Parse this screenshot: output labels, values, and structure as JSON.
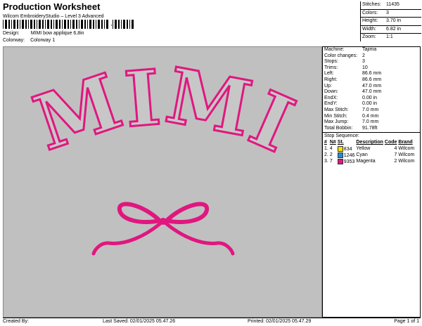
{
  "header": {
    "title": "Production Worksheet",
    "software": "Wilcom EmbroideryStudio – Level 3 Advanced",
    "barcode_comma": ","
  },
  "design": {
    "label": "Design:",
    "value": "MIMI bow applique 6,8in"
  },
  "colorway": {
    "label": "Colorway:",
    "value": "Colorway 1"
  },
  "stats": [
    {
      "label": "Stitches:",
      "value": "11435"
    },
    {
      "label": "Colors:",
      "value": "3"
    },
    {
      "label": "Height:",
      "value": "3.70 in"
    },
    {
      "label": "Width:",
      "value": "6.82 in"
    },
    {
      "label": "Zoom:",
      "value": "1:1"
    }
  ],
  "properties": [
    {
      "label": "Machine:",
      "value": "Tajima"
    },
    {
      "label": "Color changes:",
      "value": "2"
    },
    {
      "label": "Stops:",
      "value": "3"
    },
    {
      "label": "Trims:",
      "value": "10"
    },
    {
      "label": "Left:",
      "value": "86.6 mm"
    },
    {
      "label": "Right:",
      "value": "86.6 mm"
    },
    {
      "label": "Up:",
      "value": "47.0 mm"
    },
    {
      "label": "Down:",
      "value": "47.0 mm"
    },
    {
      "label": "EndX:",
      "value": "0.00 in"
    },
    {
      "label": "EndY:",
      "value": "0.00 in"
    },
    {
      "label": "Max Stitch:",
      "value": "7.0 mm"
    },
    {
      "label": "Min Stitch:",
      "value": "0.4 mm"
    },
    {
      "label": "Max Jump:",
      "value": "7.0 mm"
    },
    {
      "label": "Total Bobbin:",
      "value": "91.78ft"
    }
  ],
  "stop_sequence": {
    "heading": "Stop Sequence:",
    "columns": [
      "#",
      "N#",
      "St.",
      "Description",
      "Code",
      "Brand"
    ],
    "rows": [
      {
        "idx": "1.",
        "n": "4",
        "st": "834",
        "color": "#f2e400",
        "desc": "Yellow",
        "code": "4",
        "brand": "Wilcom"
      },
      {
        "idx": "2.",
        "n": "2",
        "st": "1246",
        "color": "#1a8fd8",
        "desc": "Cyan",
        "code": "7",
        "brand": "Wilcom"
      },
      {
        "idx": "3.",
        "n": "7",
        "st": "9353",
        "color": "#e0177f",
        "desc": "Magenta",
        "code": "2",
        "brand": "Wilcom"
      }
    ]
  },
  "design_art": {
    "text": "MIMI",
    "outline_color": "#e0177f",
    "fill_color": "#c7c7c7",
    "icon": "bow-icon"
  },
  "footer": {
    "created": "Created By:",
    "last_saved": "Last Saved: 02/01/2025 05.47.26",
    "printed": "Printed: 02/01/2025 05.47.29",
    "page": "Page 1 of 1"
  },
  "colors": {
    "canvas_bg": "#c0c0c0",
    "accent": "#e0177f"
  }
}
